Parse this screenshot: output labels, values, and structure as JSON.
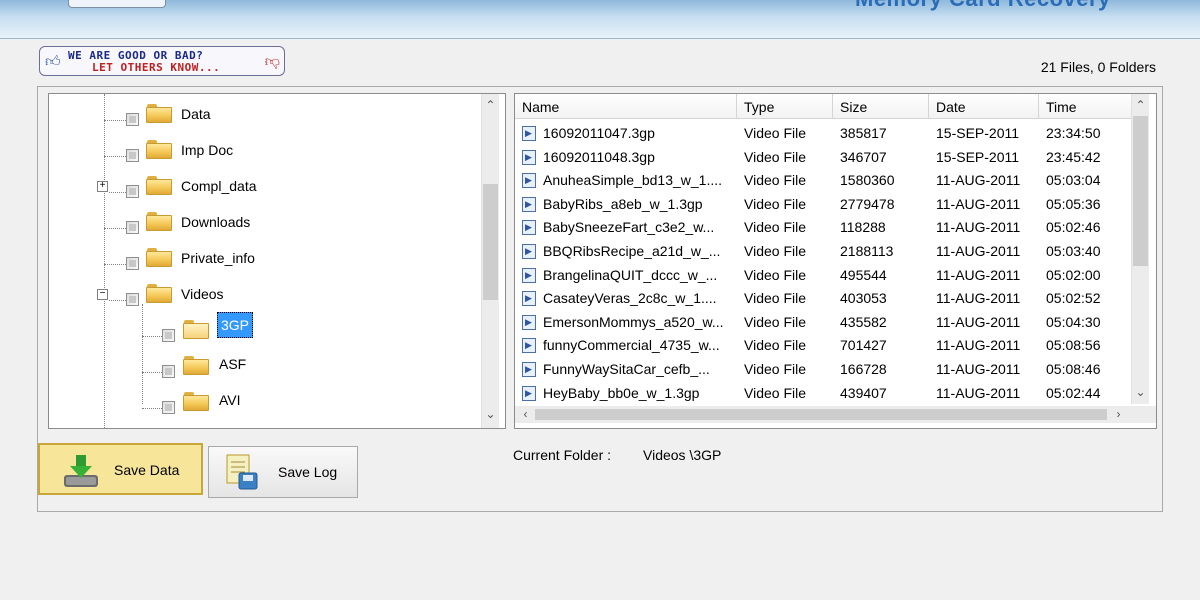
{
  "header": {
    "title": "Memory Card Recovery"
  },
  "feedback": {
    "line1": "WE ARE GOOD OR BAD?",
    "line2": "LET OTHERS KNOW..."
  },
  "summary": {
    "file_count": "21 Files, 0 Folders"
  },
  "tree": {
    "items": [
      {
        "label": "Data"
      },
      {
        "label": "Imp Doc"
      },
      {
        "label": "Compl_data"
      },
      {
        "label": "Downloads"
      },
      {
        "label": "Private_info"
      },
      {
        "label": "Videos"
      },
      {
        "label": "3GP"
      },
      {
        "label": "ASF"
      },
      {
        "label": "AVI"
      }
    ]
  },
  "filelist": {
    "columns": [
      "Name",
      "Type",
      "Size",
      "Date",
      "Time"
    ],
    "rows": [
      {
        "name": "16092011047.3gp",
        "type": "Video File",
        "size": "385817",
        "date": "15-SEP-2011",
        "time": "23:34:50"
      },
      {
        "name": "16092011048.3gp",
        "type": "Video File",
        "size": "346707",
        "date": "15-SEP-2011",
        "time": "23:45:42"
      },
      {
        "name": "AnuheaSimple_bd13_w_1....",
        "type": "Video File",
        "size": "1580360",
        "date": "11-AUG-2011",
        "time": "05:03:04"
      },
      {
        "name": "BabyRibs_a8eb_w_1.3gp",
        "type": "Video File",
        "size": "2779478",
        "date": "11-AUG-2011",
        "time": "05:05:36"
      },
      {
        "name": "BabySneezeFart_c3e2_w...",
        "type": "Video File",
        "size": "118288",
        "date": "11-AUG-2011",
        "time": "05:02:46"
      },
      {
        "name": "BBQRibsRecipe_a21d_w_...",
        "type": "Video File",
        "size": "2188113",
        "date": "11-AUG-2011",
        "time": "05:03:40"
      },
      {
        "name": "BrangelinaQUIT_dccc_w_...",
        "type": "Video File",
        "size": "495544",
        "date": "11-AUG-2011",
        "time": "05:02:00"
      },
      {
        "name": "CasateyVeras_2c8c_w_1....",
        "type": "Video File",
        "size": "403053",
        "date": "11-AUG-2011",
        "time": "05:02:52"
      },
      {
        "name": "EmersonMommys_a520_w...",
        "type": "Video File",
        "size": "435582",
        "date": "11-AUG-2011",
        "time": "05:04:30"
      },
      {
        "name": "funnyCommercial_4735_w...",
        "type": "Video File",
        "size": "701427",
        "date": "11-AUG-2011",
        "time": "05:08:56"
      },
      {
        "name": "FunnyWaySitaCar_cefb_...",
        "type": "Video File",
        "size": "166728",
        "date": "11-AUG-2011",
        "time": "05:08:46"
      },
      {
        "name": "HeyBaby_bb0e_w_1.3gp",
        "type": "Video File",
        "size": "439407",
        "date": "11-AUG-2011",
        "time": "05:02:44"
      }
    ]
  },
  "buttons": {
    "save_data": "Save Data",
    "save_log": "Save Log"
  },
  "current_folder": {
    "label": "Current Folder :",
    "value": "Videos \\3GP"
  },
  "colors": {
    "selection": "#3399ff",
    "save_button_bg": "#f7e59a",
    "header_title": "#2b6cb8"
  }
}
